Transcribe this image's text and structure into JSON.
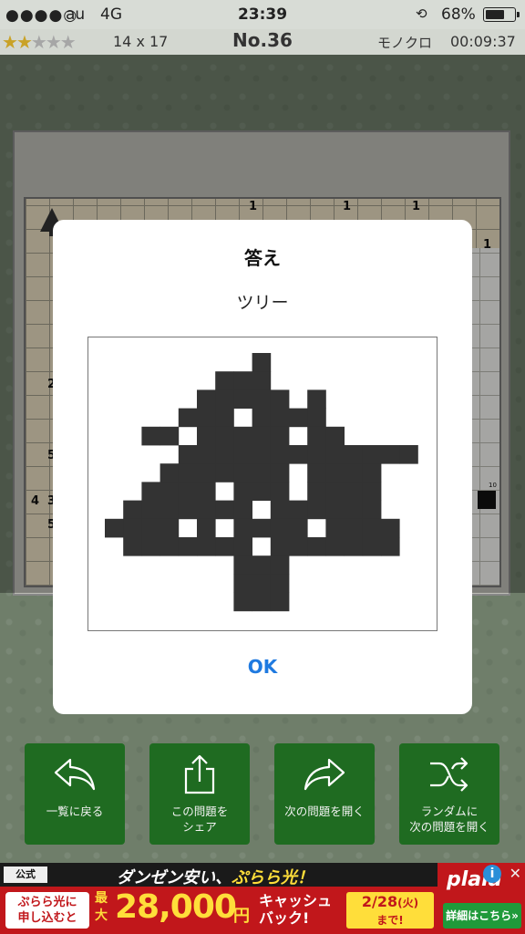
{
  "status_bar": {
    "signal": "●●●●○",
    "carrier": "au",
    "network": "4G",
    "time": "23:39",
    "battery_pct": "68%",
    "battery_level": 0.68
  },
  "info_bar": {
    "difficulty_stars": 2,
    "difficulty_max": 5,
    "grid_size": "14 x 17",
    "puzzle_number": "No.36",
    "mode": "モノクロ",
    "timer": "00:09:37"
  },
  "board": {
    "visible_numbers": [
      "1",
      "1",
      "1",
      "1",
      "2",
      "5",
      "4",
      "3",
      "5",
      "10"
    ]
  },
  "dialog": {
    "title": "答え",
    "answer_name": "ツリー",
    "ok_label": "OK",
    "grid_cols": 17,
    "grid_rows": 14,
    "fill_color": "#333333",
    "solution_rows": [
      "........#........",
      "......###........",
      ".....#####.#.....",
      "....###.####.....",
      "..##.#####.##....",
      "....#############",
      "...#######.####..",
      "..####.###.####..",
      ".#######.######..",
      "####.#.####.####.",
      ".#######.#######.",
      ".......###.......",
      ".......###.......",
      ".......###......."
    ]
  },
  "actions": [
    {
      "label": "一覧に戻る",
      "icon": "reply-icon"
    },
    {
      "label": "この問題を\nシェア",
      "icon": "share-icon"
    },
    {
      "label": "次の問題を開く",
      "icon": "forward-icon"
    },
    {
      "label": "ランダムに\n次の問題を開く",
      "icon": "shuffle-icon"
    }
  ],
  "ad": {
    "badge": "公式",
    "headline_prefix": "ダンゼン安い、",
    "headline_accent": "ぷらら光！",
    "left_cta": "ぷらら光に\n申し込むと",
    "max_label": "最大",
    "amount": "28,000",
    "yen": "円",
    "cashback": "キャッシュ\nバック!",
    "date": "2/28",
    "date_day": "(火)",
    "date_suffix": "まで!",
    "logo": "plala",
    "detail": "詳細はこちら»",
    "accent_color": "#ffde3a",
    "bg_color": "#c1171b"
  }
}
